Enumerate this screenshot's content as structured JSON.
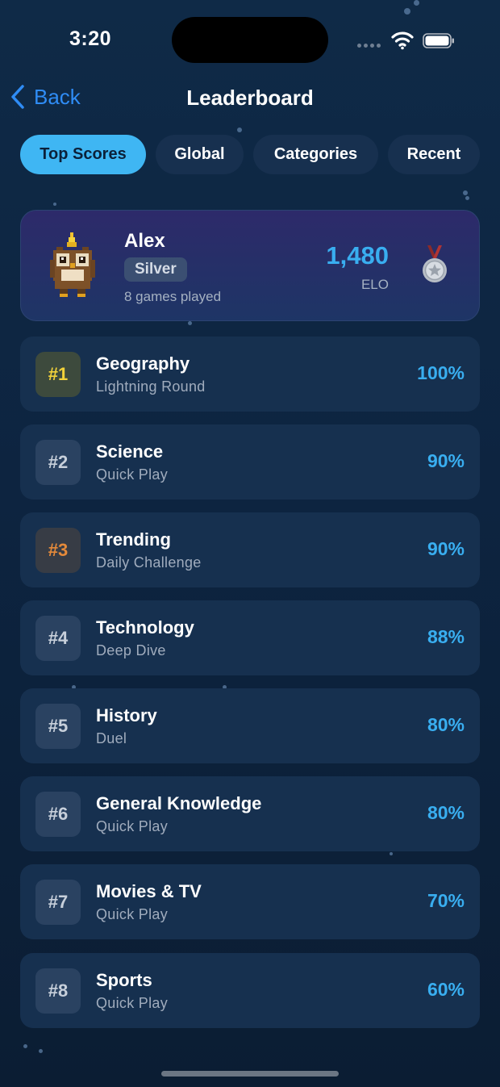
{
  "status": {
    "time": "3:20"
  },
  "nav": {
    "back_label": "Back",
    "title": "Leaderboard"
  },
  "tabs": [
    {
      "label": "Top Scores",
      "active": true
    },
    {
      "label": "Global",
      "active": false
    },
    {
      "label": "Categories",
      "active": false
    },
    {
      "label": "Recent",
      "active": false
    }
  ],
  "profile": {
    "name": "Alex",
    "tier": "Silver",
    "games_played": "8 games played",
    "elo": "1,480",
    "elo_label": "ELO",
    "avatar_icon": "owl-icon",
    "medal_icon": "silver-medal-icon"
  },
  "scores": [
    {
      "rank": "#1",
      "category": "Geography",
      "mode": "Lightning Round",
      "percent": "100%"
    },
    {
      "rank": "#2",
      "category": "Science",
      "mode": "Quick Play",
      "percent": "90%"
    },
    {
      "rank": "#3",
      "category": "Trending",
      "mode": "Daily Challenge",
      "percent": "90%"
    },
    {
      "rank": "#4",
      "category": "Technology",
      "mode": "Deep Dive",
      "percent": "88%"
    },
    {
      "rank": "#5",
      "category": "History",
      "mode": "Duel",
      "percent": "80%"
    },
    {
      "rank": "#6",
      "category": "General Knowledge",
      "mode": "Quick Play",
      "percent": "80%"
    },
    {
      "rank": "#7",
      "category": "Movies & TV",
      "mode": "Quick Play",
      "percent": "70%"
    },
    {
      "rank": "#8",
      "category": "Sports",
      "mode": "Quick Play",
      "percent": "60%"
    }
  ],
  "colors": {
    "accent": "#39aef0",
    "active_tab": "#3fb6f3",
    "gold": "#f2d23a",
    "bronze": "#e58a3a",
    "back_link": "#2f8cf5"
  }
}
